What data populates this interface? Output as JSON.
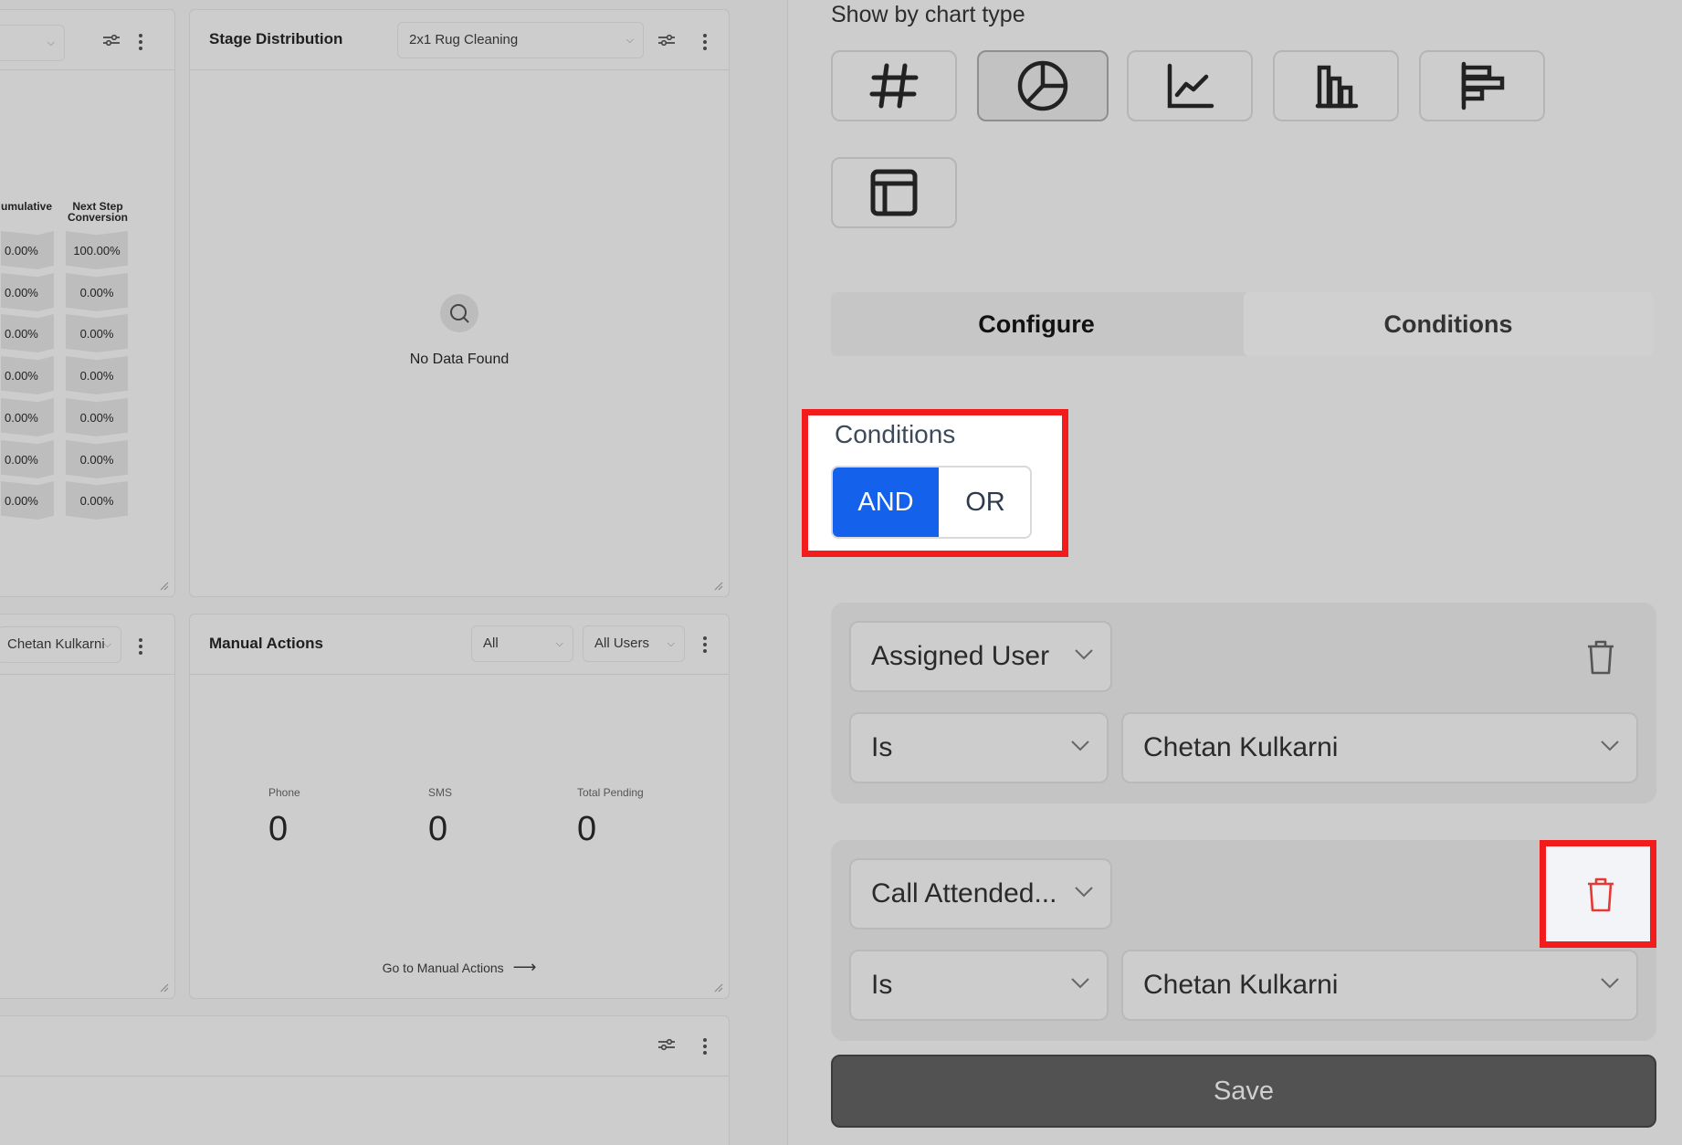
{
  "dashboard": {
    "funnel_card": {
      "col_cumulative": "umulative",
      "col_next_step": "Next Step Conversion",
      "cumulative_values": [
        "0.00%",
        "0.00%",
        "0.00%",
        "0.00%",
        "0.00%",
        "0.00%",
        "0.00%"
      ],
      "next_step_values": [
        "100.00%",
        "0.00%",
        "0.00%",
        "0.00%",
        "0.00%",
        "0.00%",
        "0.00%"
      ]
    },
    "stage_card": {
      "title": "Stage Distribution",
      "pipeline_select": "2x1 Rug Cleaning",
      "empty_text": "No Data Found"
    },
    "user_card": {
      "user_select": "Chetan Kulkarni"
    },
    "manual_actions_card": {
      "title": "Manual Actions",
      "filter_select": "All",
      "users_select": "All Users",
      "stats": [
        {
          "label": "Phone",
          "value": "0"
        },
        {
          "label": "SMS",
          "value": "0"
        },
        {
          "label": "Total Pending",
          "value": "0"
        }
      ],
      "link_text": "Go to Manual Actions"
    }
  },
  "panel": {
    "chart_type_label": "Show by chart type",
    "chart_types": [
      {
        "icon": "hash-icon",
        "active": false
      },
      {
        "icon": "pie-chart-icon",
        "active": true
      },
      {
        "icon": "line-chart-icon",
        "active": false
      },
      {
        "icon": "bar-chart-icon",
        "active": false
      },
      {
        "icon": "horizontal-bar-chart-icon",
        "active": false
      },
      {
        "icon": "table-icon",
        "active": false
      }
    ],
    "tabs": {
      "configure": "Configure",
      "conditions": "Conditions"
    },
    "conditions": {
      "label": "Conditions",
      "and_label": "AND",
      "or_label": "OR",
      "selected": "AND"
    },
    "condition_rows": [
      {
        "field": "Assigned User",
        "operator": "Is",
        "value": "Chetan Kulkarni"
      },
      {
        "field": "Call Attended...",
        "operator": "Is",
        "value": "Chetan Kulkarni"
      }
    ],
    "save_label": "Save"
  },
  "colors": {
    "accent": "#1462eb",
    "highlight": "#f21c1c",
    "trash_active": "#e53935"
  }
}
